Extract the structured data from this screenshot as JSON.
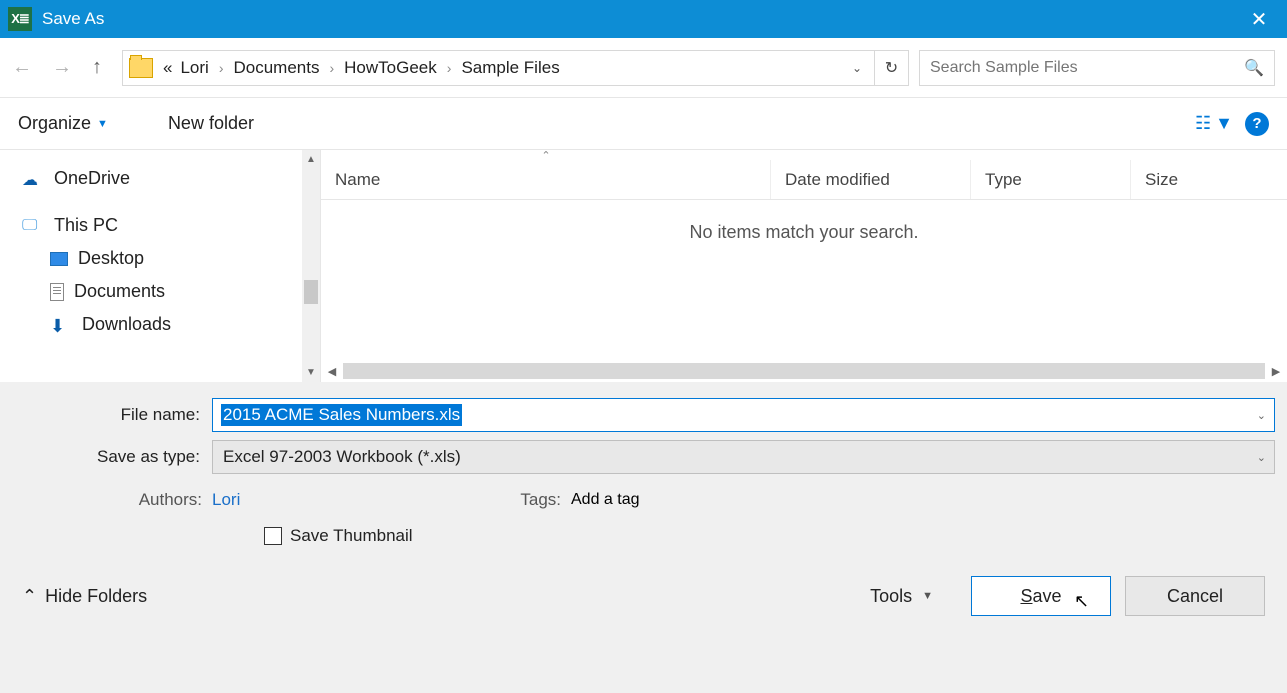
{
  "title_bar": {
    "title": "Save As",
    "app_icon_text": "X≣"
  },
  "nav": {
    "breadcrumb": {
      "prefix": "«",
      "parts": [
        "Lori",
        "Documents",
        "HowToGeek",
        "Sample Files"
      ]
    },
    "search_placeholder": "Search Sample Files"
  },
  "toolbar": {
    "organize": "Organize",
    "new_folder": "New folder"
  },
  "tree": {
    "onedrive": "OneDrive",
    "this_pc": "This PC",
    "desktop": "Desktop",
    "documents": "Documents",
    "downloads": "Downloads"
  },
  "files": {
    "columns": {
      "name": "Name",
      "date": "Date modified",
      "type": "Type",
      "size": "Size"
    },
    "empty_message": "No items match your search."
  },
  "form": {
    "file_name_label": "File name:",
    "file_name_value": "2015 ACME Sales Numbers.xls",
    "type_label": "Save as type:",
    "type_value": "Excel 97-2003 Workbook (*.xls)",
    "authors_label": "Authors:",
    "authors_value": "Lori",
    "tags_label": "Tags:",
    "tags_value": "Add a tag",
    "save_thumbnail": "Save Thumbnail"
  },
  "bottom": {
    "hide_folders": "Hide Folders",
    "tools": "Tools",
    "save": "Save",
    "cancel": "Cancel"
  }
}
